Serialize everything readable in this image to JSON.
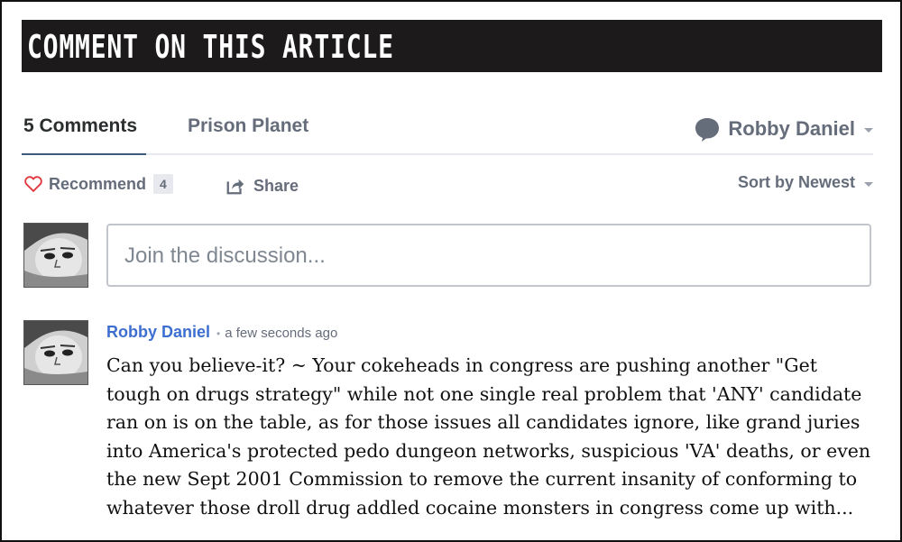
{
  "banner": {
    "title": "COMMENT ON THIS ARTICLE"
  },
  "nav": {
    "comments_tab": "5 Comments",
    "site_tab": "Prison Planet",
    "user_name": "Robby Daniel"
  },
  "actions": {
    "recommend_label": "Recommend",
    "recommend_count": "4",
    "share_label": "Share",
    "sort_label": "Sort by Newest"
  },
  "composer": {
    "placeholder": "Join the discussion..."
  },
  "comment": {
    "author": "Robby Daniel",
    "separator": "•",
    "time": "a few seconds ago",
    "body": "Can you believe-it? ~ Your cokeheads in congress are pushing another \"Get tough on drugs strategy\" while not one single real problem that 'ANY' candidate ran on is on the table, as for those issues all candidates ignore, like grand juries into America's protected pedo dungeon networks, suspicious 'VA' deaths, or even the new Sept 2001 Commission to remove the current insanity of conforming to whatever those droll drug addled cocaine monsters in congress come up with..."
  },
  "colors": {
    "banner_bg": "#1c1a1b",
    "author_link": "#3d6fd0",
    "muted_text": "#656c7a",
    "heart": "#e0383e"
  },
  "icons": {
    "user": "speech-bubble-icon",
    "recommend": "heart-icon",
    "share": "share-icon",
    "caret": "chevron-down-icon"
  }
}
